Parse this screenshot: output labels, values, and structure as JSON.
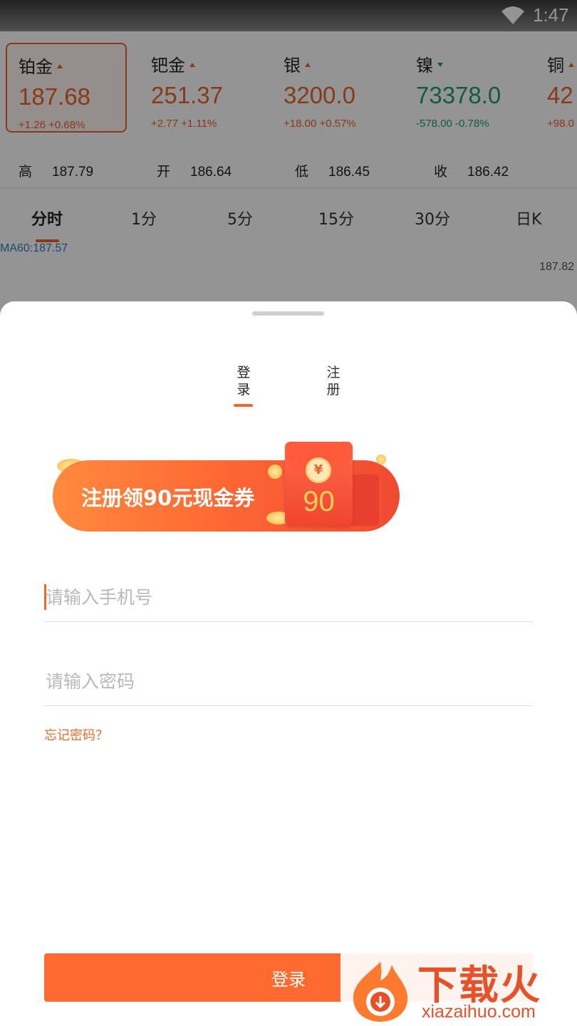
{
  "status_bar": {
    "time": "1:47"
  },
  "tickers": [
    {
      "name": "铂金",
      "price": "187.68",
      "change": "+1.26  +0.68%",
      "dir": "up"
    },
    {
      "name": "钯金",
      "price": "251.37",
      "change": "+2.77  +1.11%",
      "dir": "up"
    },
    {
      "name": "银",
      "price": "3200.0",
      "change": "+18.00  +0.57%",
      "dir": "up"
    },
    {
      "name": "镍",
      "price": "73378.0",
      "change": "-578.00  -0.78%",
      "dir": "down"
    },
    {
      "name": "铜",
      "price": "42",
      "change": "+98.0",
      "dir": "up"
    }
  ],
  "ohlc": {
    "high_label": "高",
    "high": "187.79",
    "open_label": "开",
    "open": "186.64",
    "low_label": "低",
    "low": "186.45",
    "close_label": "收",
    "close": "186.42"
  },
  "periods": [
    "分时",
    "1分",
    "5分",
    "15分",
    "30分",
    "日K"
  ],
  "chart": {
    "ma_label": "MA60:187.57",
    "price_label": "187.82"
  },
  "auth_tabs": {
    "login": [
      "登",
      "录"
    ],
    "register": [
      "注",
      "册"
    ]
  },
  "promo": {
    "text": "注册领90元现金券",
    "coin_symbol": "¥",
    "amount": "90"
  },
  "form": {
    "phone_placeholder": "请输入手机号",
    "password_placeholder": "请输入密码",
    "forgot_label": "忘记密码？",
    "login_button": "登录"
  },
  "watermark": {
    "title": "下载火",
    "url": "xiazaihuo.com"
  },
  "colors": {
    "accent": "#f0692c",
    "up": "#e8622c",
    "down": "#1aa06a",
    "button": "#ff6a30"
  }
}
